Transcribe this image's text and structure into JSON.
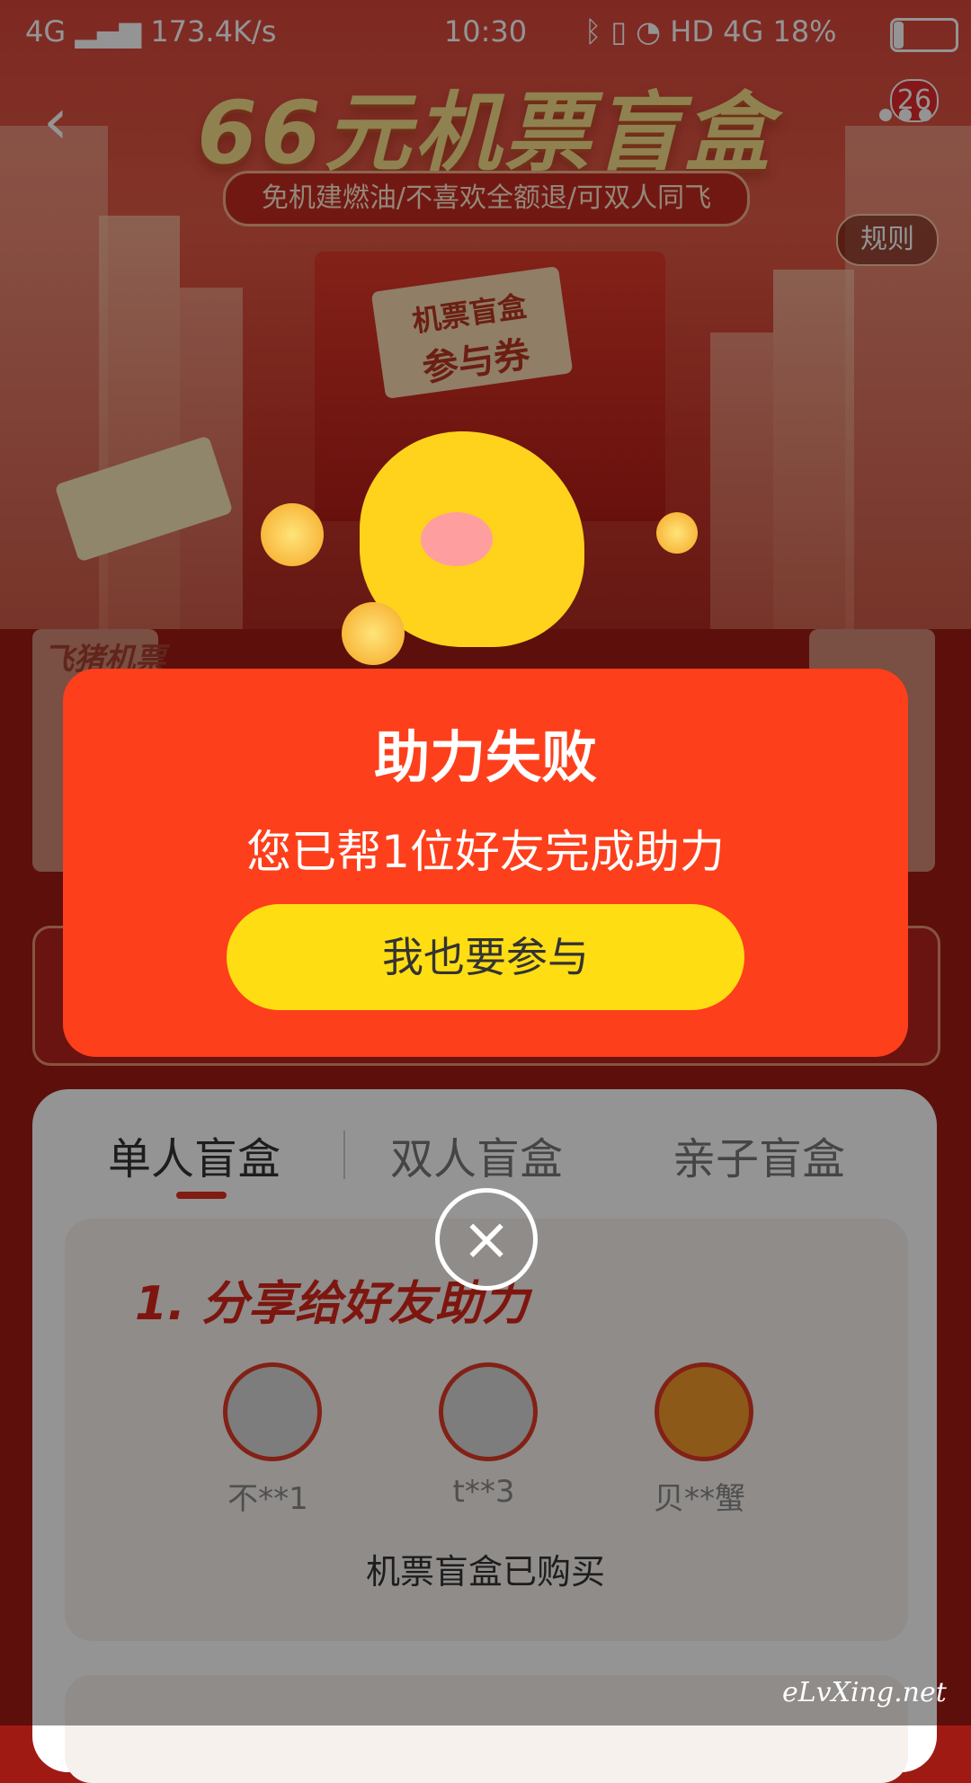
{
  "status_bar": {
    "network": "4G",
    "speed": "173.4K/s",
    "time": "10:30",
    "right_indicators": "HD 4G",
    "battery": "18%",
    "battery_level": 0.18
  },
  "hero": {
    "title": "66元机票盲盒",
    "subtitle": "免机建燃油/不喜欢全额退/可双人同飞",
    "coupon_line1": "机票盲盒",
    "coupon_line2": "参与券",
    "rules_label": "规则",
    "badge_count": "26"
  },
  "page": {
    "side_card_label": "飞猪机票",
    "tabs": [
      "单人盲盒",
      "双人盲盒",
      "亲子盲盒"
    ],
    "active_tab": "单人盲盒",
    "share_section_title": "1. 分享给好友助力",
    "helpers": [
      "不**1",
      "t**3",
      "贝**蟹"
    ],
    "purchased_text": "机票盲盒已购买"
  },
  "modal": {
    "title": "助力失败",
    "message": "您已帮1位好友完成助力",
    "button_label": "我也要参与"
  },
  "close_symbol": "×",
  "watermark": "eLvXing.net",
  "colors": {
    "modal_bg": "#fe3f1b",
    "button_yellow": "#ffdd13",
    "accent_red": "#e0301e"
  }
}
